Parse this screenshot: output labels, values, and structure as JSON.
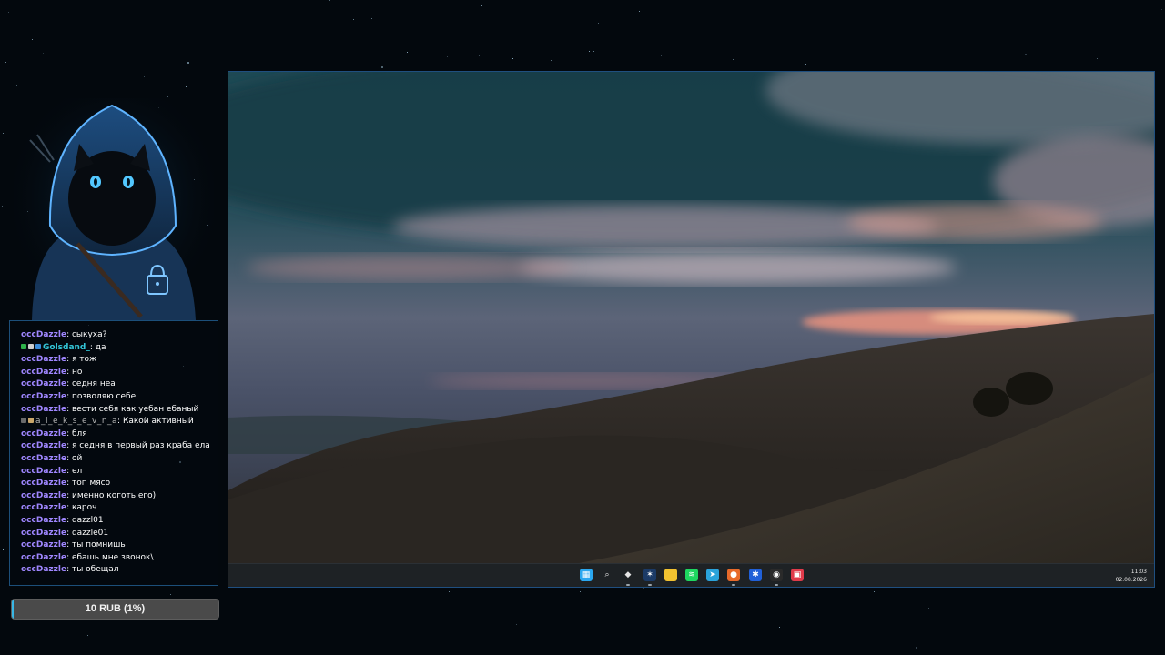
{
  "chat": {
    "messages": [
      {
        "user": "occDazzle",
        "text": "сыкуха?",
        "style": "purple",
        "badges": []
      },
      {
        "user": "Golsdand_",
        "text": "да",
        "style": "teal",
        "badges": [
          "#2fb24a",
          "#d0d0d0",
          "#3a8bd9"
        ]
      },
      {
        "user": "occDazzle",
        "text": "я тож",
        "style": "purple",
        "badges": []
      },
      {
        "user": "occDazzle",
        "text": "но",
        "style": "purple",
        "badges": []
      },
      {
        "user": "occDazzle",
        "text": "седня неа",
        "style": "purple",
        "badges": []
      },
      {
        "user": "occDazzle",
        "text": "позволяю себе",
        "style": "purple",
        "badges": []
      },
      {
        "user": "occDazzle",
        "text": "вести себя как уебан ебаный",
        "style": "purple",
        "badges": []
      },
      {
        "user": "a_l_e_k_s_e_v_n_a",
        "text": "Какой активный",
        "style": "grey",
        "badges": [
          "#6a6a6a",
          "#c9a66b"
        ]
      },
      {
        "user": "occDazzle",
        "text": "бля",
        "style": "purple",
        "badges": []
      },
      {
        "user": "occDazzle",
        "text": "я седня в первый раз краба ела",
        "style": "purple",
        "badges": []
      },
      {
        "user": "occDazzle",
        "text": "ой",
        "style": "purple",
        "badges": []
      },
      {
        "user": "occDazzle",
        "text": "ел",
        "style": "purple",
        "badges": []
      },
      {
        "user": "occDazzle",
        "text": "топ мясо",
        "style": "purple",
        "badges": []
      },
      {
        "user": "occDazzle",
        "text": "именно коготь его)",
        "style": "purple",
        "badges": []
      },
      {
        "user": "occDazzle",
        "text": "кароч",
        "style": "purple",
        "badges": []
      },
      {
        "user": "occDazzle",
        "text": "dazzl01",
        "style": "purple",
        "badges": []
      },
      {
        "user": "occDazzle",
        "text": "dazzle01",
        "style": "purple",
        "badges": []
      },
      {
        "user": "occDazzle",
        "text": "ты помнишь",
        "style": "purple",
        "badges": []
      },
      {
        "user": "occDazzle",
        "text": "ебашь мне звонок\\",
        "style": "purple",
        "badges": []
      },
      {
        "user": "occDazzle",
        "text": "ты обещал",
        "style": "purple",
        "badges": []
      }
    ]
  },
  "donation": {
    "label": "10 RUB (1%)",
    "progress_percent": 1
  },
  "taskbar": {
    "icons": [
      {
        "name": "start-icon",
        "color": "#2aa7f0",
        "glyph": "▦",
        "running": false
      },
      {
        "name": "search-icon",
        "color": "transparent",
        "glyph": "⌕",
        "running": false
      },
      {
        "name": "app-diamond-icon",
        "color": "transparent",
        "glyph": "◆",
        "running": true
      },
      {
        "name": "app-dev-icon",
        "color": "#1b3a66",
        "glyph": "✶",
        "running": true
      },
      {
        "name": "file-explorer-icon",
        "color": "#f2c230",
        "glyph": "",
        "running": false
      },
      {
        "name": "spotify-icon",
        "color": "#1ed760",
        "glyph": "≋",
        "running": false
      },
      {
        "name": "telegram-icon",
        "color": "#2aa3db",
        "glyph": "➤",
        "running": false
      },
      {
        "name": "firefox-icon",
        "color": "#e86a2a",
        "glyph": "●",
        "running": true
      },
      {
        "name": "snowflake-app-icon",
        "color": "#2060d8",
        "glyph": "✱",
        "running": false
      },
      {
        "name": "obs-icon",
        "color": "#2a2a2a",
        "glyph": "◉",
        "running": true
      },
      {
        "name": "red-app-icon",
        "color": "#e03a4a",
        "glyph": "▣",
        "running": false
      }
    ],
    "time": "11:03",
    "date": "02.08.2026"
  },
  "colors": {
    "username_purple": "#9f86ff",
    "username_teal": "#33c6d8",
    "panel_border": "#1c4f7a",
    "progress_fill": "#38b7e6"
  }
}
